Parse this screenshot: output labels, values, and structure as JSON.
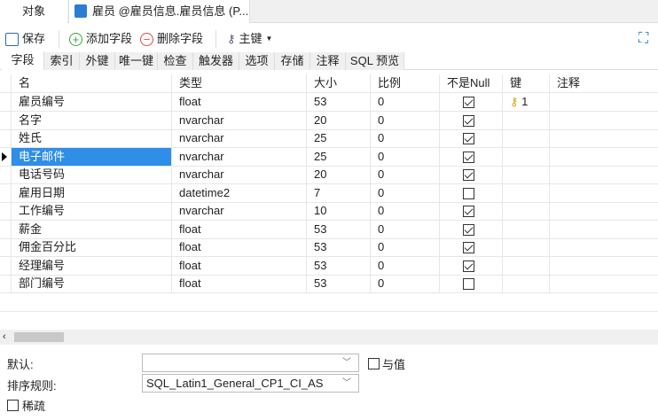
{
  "tabs": {
    "objects": "对象",
    "editor": "雇员 @雇员信息.雇员信息 (P..."
  },
  "toolbar": {
    "save": "保存",
    "add_field": "添加字段",
    "delete_field": "删除字段",
    "primary_key": "主键"
  },
  "subtabs": [
    "字段",
    "索引",
    "外键",
    "唯一键",
    "检查",
    "触发器",
    "选项",
    "存储",
    "注释",
    "SQL 预览"
  ],
  "columns": [
    "名",
    "类型",
    "大小",
    "比例",
    "不是Null",
    "键",
    "注释"
  ],
  "rows": [
    {
      "name": "雇员编号",
      "type": "float",
      "size": "53",
      "scale": "0",
      "not_null": true,
      "key": "1"
    },
    {
      "name": "名字",
      "type": "nvarchar",
      "size": "20",
      "scale": "0",
      "not_null": true,
      "key": ""
    },
    {
      "name": "姓氏",
      "type": "nvarchar",
      "size": "25",
      "scale": "0",
      "not_null": true,
      "key": ""
    },
    {
      "name": "电子邮件",
      "type": "nvarchar",
      "size": "25",
      "scale": "0",
      "not_null": true,
      "key": ""
    },
    {
      "name": "电话号码",
      "type": "nvarchar",
      "size": "20",
      "scale": "0",
      "not_null": true,
      "key": ""
    },
    {
      "name": "雇用日期",
      "type": "datetime2",
      "size": "7",
      "scale": "0",
      "not_null": false,
      "key": ""
    },
    {
      "name": "工作编号",
      "type": "nvarchar",
      "size": "10",
      "scale": "0",
      "not_null": true,
      "key": ""
    },
    {
      "name": "薪金",
      "type": "float",
      "size": "53",
      "scale": "0",
      "not_null": true,
      "key": ""
    },
    {
      "name": "佣金百分比",
      "type": "float",
      "size": "53",
      "scale": "0",
      "not_null": true,
      "key": ""
    },
    {
      "name": "经理编号",
      "type": "float",
      "size": "53",
      "scale": "0",
      "not_null": true,
      "key": ""
    },
    {
      "name": "部门编号",
      "type": "float",
      "size": "53",
      "scale": "0",
      "not_null": false,
      "key": ""
    }
  ],
  "selected_row": 3,
  "form": {
    "default_label": "默认:",
    "default_value": "",
    "with_value": "与值",
    "collation_label": "排序规则:",
    "collation_value": "SQL_Latin1_General_CP1_CI_AS",
    "sparse": "稀疏"
  }
}
